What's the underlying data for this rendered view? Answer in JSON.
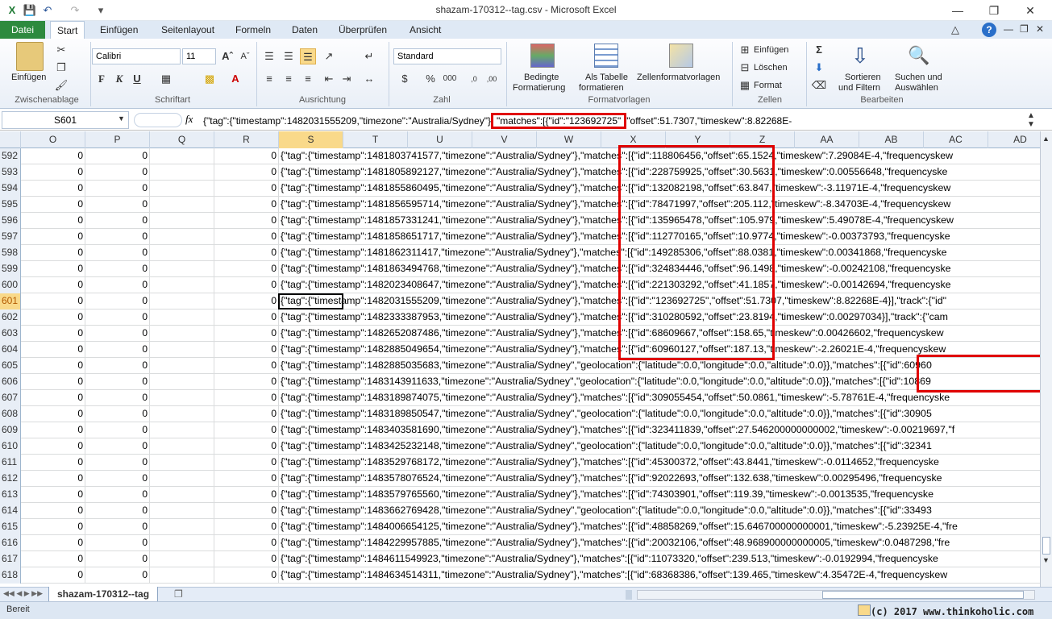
{
  "window": {
    "title": "shazam-170312--tag.csv  -  Microsoft Excel"
  },
  "tabs": [
    "Datei",
    "Start",
    "Einfügen",
    "Seitenlayout",
    "Formeln",
    "Daten",
    "Überprüfen",
    "Ansicht"
  ],
  "ribbon": {
    "clipboard": {
      "paste": "Einfügen",
      "label": "Zwischenablage"
    },
    "font": {
      "name": "Calibri",
      "size": "11",
      "label": "Schriftart",
      "bold": "F",
      "italic": "K",
      "underline": "U"
    },
    "alignment": {
      "label": "Ausrichtung"
    },
    "number": {
      "format": "Standard",
      "label": "Zahl"
    },
    "styles": {
      "conditional": "Bedingte\nFormatierung",
      "conditional1": "Bedingte",
      "conditional2": "Formatierung",
      "table1": "Als Tabelle",
      "table2": "formatieren",
      "cellstyles": "Zellenformatvorlagen",
      "label": "Formatvorlagen"
    },
    "cells": {
      "insert": "Einfügen",
      "delete": "Löschen",
      "format": "Format",
      "label": "Zellen"
    },
    "editing": {
      "sort1": "Sortieren",
      "sort2": "und Filtern",
      "find1": "Suchen und",
      "find2": "Auswählen",
      "label": "Bearbeiten"
    }
  },
  "formula_bar": {
    "name_box": "S601",
    "fx": "fx",
    "content_prefix": "{\"tag\":{\"timestamp\":1482031555209,\"timezone\":\"Australia/Sydney\"}",
    "content_highlight": "\"matches\":[{\"id\":\"123692725\"",
    "content_suffix": "\"offset\":51.7307,\"timeskew\":8.82268E-"
  },
  "columns": [
    "O",
    "P",
    "Q",
    "R",
    "S",
    "T",
    "U",
    "V",
    "W",
    "X",
    "Y",
    "Z",
    "AA",
    "AB",
    "AC",
    "AD"
  ],
  "rows": [
    {
      "n": "592",
      "o": "0",
      "p": "0",
      "r": "0",
      "text": "{\"tag\":{\"timestamp\":1481803741577,\"timezone\":\"Australia/Sydney\"},\"matches\":[{\"id\":118806456,\"offset\":65.1524,\"timeskew\":7.29084E-4,\"frequencyskew"
    },
    {
      "n": "593",
      "o": "0",
      "p": "0",
      "r": "0",
      "text": "{\"tag\":{\"timestamp\":1481805892127,\"timezone\":\"Australia/Sydney\"},\"matches\":[{\"id\":228759925,\"offset\":30.5631,\"timeskew\":0.00556648,\"frequencyske"
    },
    {
      "n": "594",
      "o": "0",
      "p": "0",
      "r": "0",
      "text": "{\"tag\":{\"timestamp\":1481855860495,\"timezone\":\"Australia/Sydney\"},\"matches\":[{\"id\":132082198,\"offset\":63.847,\"timeskew\":-3.11971E-4,\"frequencyskew"
    },
    {
      "n": "595",
      "o": "0",
      "p": "0",
      "r": "0",
      "text": "{\"tag\":{\"timestamp\":1481856595714,\"timezone\":\"Australia/Sydney\"},\"matches\":[{\"id\":78471997,\"offset\":205.112,\"timeskew\":-8.34703E-4,\"frequencyskew"
    },
    {
      "n": "596",
      "o": "0",
      "p": "0",
      "r": "0",
      "text": "{\"tag\":{\"timestamp\":1481857331241,\"timezone\":\"Australia/Sydney\"},\"matches\":[{\"id\":135965478,\"offset\":105.979,\"timeskew\":5.49078E-4,\"frequencyskew"
    },
    {
      "n": "597",
      "o": "0",
      "p": "0",
      "r": "0",
      "text": "{\"tag\":{\"timestamp\":1481858651717,\"timezone\":\"Australia/Sydney\"},\"matches\":[{\"id\":112770165,\"offset\":10.9774,\"timeskew\":-0.00373793,\"frequencyske"
    },
    {
      "n": "598",
      "o": "0",
      "p": "0",
      "r": "0",
      "text": "{\"tag\":{\"timestamp\":1481862311417,\"timezone\":\"Australia/Sydney\"},\"matches\":[{\"id\":149285306,\"offset\":88.0381,\"timeskew\":0.00341868,\"frequencyske"
    },
    {
      "n": "599",
      "o": "0",
      "p": "0",
      "r": "0",
      "text": "{\"tag\":{\"timestamp\":1481863494768,\"timezone\":\"Australia/Sydney\"},\"matches\":[{\"id\":324834446,\"offset\":96.1498,\"timeskew\":-0.00242108,\"frequencyske"
    },
    {
      "n": "600",
      "o": "0",
      "p": "0",
      "r": "0",
      "text": "{\"tag\":{\"timestamp\":1482023408647,\"timezone\":\"Australia/Sydney\"},\"matches\":[{\"id\":221303292,\"offset\":41.1857,\"timeskew\":-0.00142694,\"frequencyske"
    },
    {
      "n": "601",
      "o": "0",
      "p": "0",
      "r": "0",
      "text": "{\"tag\":{\"timestamp\":1482031555209,\"timezone\":\"Australia/Sydney\"},\"matches\":[{\"id\":\"123692725\",\"offset\":51.7307,\"timeskew\":8.82268E-4}],\"track\":{\"id\""
    },
    {
      "n": "602",
      "o": "0",
      "p": "0",
      "r": "0",
      "text": "{\"tag\":{\"timestamp\":1482333387953,\"timezone\":\"Australia/Sydney\"},\"matches\":[{\"id\":310280592,\"offset\":23.8194,\"timeskew\":0.00297034}],\"track\":{\"cam"
    },
    {
      "n": "603",
      "o": "0",
      "p": "0",
      "r": "0",
      "text": "{\"tag\":{\"timestamp\":1482652087486,\"timezone\":\"Australia/Sydney\"},\"matches\":[{\"id\":68609667,\"offset\":158.65,\"timeskew\":0.00426602,\"frequencyskew"
    },
    {
      "n": "604",
      "o": "0",
      "p": "0",
      "r": "0",
      "text": "{\"tag\":{\"timestamp\":1482885049654,\"timezone\":\"Australia/Sydney\"},\"matches\":[{\"id\":60960127,\"offset\":187.13,\"timeskew\":-2.26021E-4,\"frequencyskew"
    },
    {
      "n": "605",
      "o": "0",
      "p": "0",
      "r": "0",
      "text": "{\"tag\":{\"timestamp\":1482885035683,\"timezone\":\"Australia/Sydney\",\"geolocation\":{\"latitude\":0.0,\"longitude\":0.0,\"altitude\":0.0}},\"matches\":[{\"id\":60960"
    },
    {
      "n": "606",
      "o": "0",
      "p": "0",
      "r": "0",
      "text": "{\"tag\":{\"timestamp\":1483143911633,\"timezone\":\"Australia/Sydney\",\"geolocation\":{\"latitude\":0.0,\"longitude\":0.0,\"altitude\":0.0}},\"matches\":[{\"id\":10869"
    },
    {
      "n": "607",
      "o": "0",
      "p": "0",
      "r": "0",
      "text": "{\"tag\":{\"timestamp\":1483189874075,\"timezone\":\"Australia/Sydney\"},\"matches\":[{\"id\":309055454,\"offset\":50.0861,\"timeskew\":-5.78761E-4,\"frequencyske"
    },
    {
      "n": "608",
      "o": "0",
      "p": "0",
      "r": "0",
      "text": "{\"tag\":{\"timestamp\":1483189850547,\"timezone\":\"Australia/Sydney\",\"geolocation\":{\"latitude\":0.0,\"longitude\":0.0,\"altitude\":0.0}},\"matches\":[{\"id\":30905"
    },
    {
      "n": "609",
      "o": "0",
      "p": "0",
      "r": "0",
      "text": "{\"tag\":{\"timestamp\":1483403581690,\"timezone\":\"Australia/Sydney\"},\"matches\":[{\"id\":323411839,\"offset\":27.546200000000002,\"timeskew\":-0.00219697,\"f"
    },
    {
      "n": "610",
      "o": "0",
      "p": "0",
      "r": "0",
      "text": "{\"tag\":{\"timestamp\":1483425232148,\"timezone\":\"Australia/Sydney\",\"geolocation\":{\"latitude\":0.0,\"longitude\":0.0,\"altitude\":0.0}},\"matches\":[{\"id\":32341"
    },
    {
      "n": "611",
      "o": "0",
      "p": "0",
      "r": "0",
      "text": "{\"tag\":{\"timestamp\":1483529768172,\"timezone\":\"Australia/Sydney\"},\"matches\":[{\"id\":45300372,\"offset\":43.8441,\"timeskew\":-0.0114652,\"frequencyske"
    },
    {
      "n": "612",
      "o": "0",
      "p": "0",
      "r": "0",
      "text": "{\"tag\":{\"timestamp\":1483578076524,\"timezone\":\"Australia/Sydney\"},\"matches\":[{\"id\":92022693,\"offset\":132.638,\"timeskew\":0.00295496,\"frequencyske"
    },
    {
      "n": "613",
      "o": "0",
      "p": "0",
      "r": "0",
      "text": "{\"tag\":{\"timestamp\":1483579765560,\"timezone\":\"Australia/Sydney\"},\"matches\":[{\"id\":74303901,\"offset\":119.39,\"timeskew\":-0.0013535,\"frequencyske"
    },
    {
      "n": "614",
      "o": "0",
      "p": "0",
      "r": "0",
      "text": "{\"tag\":{\"timestamp\":1483662769428,\"timezone\":\"Australia/Sydney\",\"geolocation\":{\"latitude\":0.0,\"longitude\":0.0,\"altitude\":0.0}},\"matches\":[{\"id\":33493"
    },
    {
      "n": "615",
      "o": "0",
      "p": "0",
      "r": "0",
      "text": "{\"tag\":{\"timestamp\":1484006654125,\"timezone\":\"Australia/Sydney\"},\"matches\":[{\"id\":48858269,\"offset\":15.646700000000001,\"timeskew\":-5.23925E-4,\"fre"
    },
    {
      "n": "616",
      "o": "0",
      "p": "0",
      "r": "0",
      "text": "{\"tag\":{\"timestamp\":1484229957885,\"timezone\":\"Australia/Sydney\"},\"matches\":[{\"id\":20032106,\"offset\":48.968900000000005,\"timeskew\":0.0487298,\"fre"
    },
    {
      "n": "617",
      "o": "0",
      "p": "0",
      "r": "0",
      "text": "{\"tag\":{\"timestamp\":1484611549923,\"timezone\":\"Australia/Sydney\"},\"matches\":[{\"id\":11073320,\"offset\":239.513,\"timeskew\":-0.0192994,\"frequencyske"
    },
    {
      "n": "618",
      "o": "0",
      "p": "0",
      "r": "0",
      "text": "{\"tag\":{\"timestamp\":1484634514311,\"timezone\":\"Australia/Sydney\"},\"matches\":[{\"id\":68368386,\"offset\":139.465,\"timeskew\":4.35472E-4,\"frequencyskew"
    }
  ],
  "sheet_tab": "shazam-170312--tag",
  "status": "Bereit",
  "watermark": "(c) 2017 www.thinkoholic.com",
  "colors": {
    "highlight": "#e00000",
    "file_tab": "#2d8a3e",
    "selected_header": "#f9d98a"
  }
}
